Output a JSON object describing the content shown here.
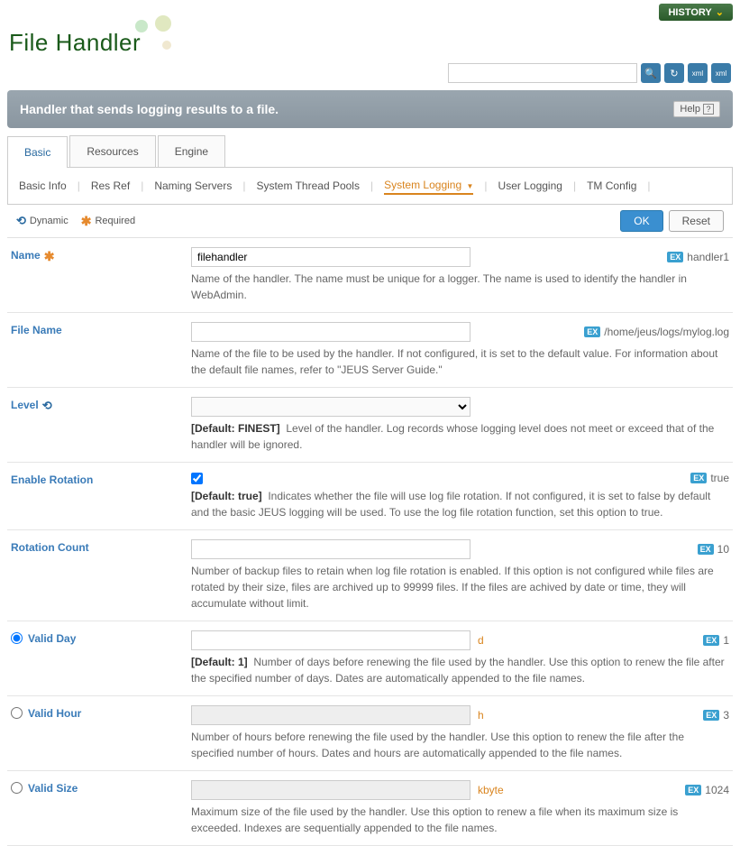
{
  "header": {
    "history_label": "HISTORY",
    "page_title": "File Handler",
    "search_placeholder": ""
  },
  "banner": {
    "description": "Handler that sends logging results to a file.",
    "help_label": "Help"
  },
  "tabs": {
    "items": [
      "Basic",
      "Resources",
      "Engine"
    ],
    "active": 0
  },
  "subtabs": {
    "items": [
      "Basic Info",
      "Res Ref",
      "Naming Servers",
      "System Thread Pools",
      "System Logging",
      "User Logging",
      "TM Config"
    ],
    "active": 4
  },
  "legend": {
    "dynamic": "Dynamic",
    "required": "Required"
  },
  "buttons": {
    "ok": "OK",
    "reset": "Reset"
  },
  "fields": {
    "name": {
      "label": "Name",
      "value": "filehandler",
      "example": "handler1",
      "desc": "Name of the handler. The name must be unique for a logger. The name is used to identify the handler in WebAdmin."
    },
    "file_name": {
      "label": "File Name",
      "value": "",
      "example": "/home/jeus/logs/mylog.log",
      "desc": "Name of the file to be used by the handler. If not configured, it is set to the default value. For information about the default file names, refer to \"JEUS Server Guide.\""
    },
    "level": {
      "label": "Level",
      "default_prefix": "[Default: FINEST]",
      "desc": "Level of the handler. Log records whose logging level does not meet or exceed that of the handler will be ignored."
    },
    "enable_rotation": {
      "label": "Enable Rotation",
      "checked": true,
      "example": "true",
      "default_prefix": "[Default: true]",
      "desc": "Indicates whether the file will use log file rotation. If not configured, it is set to false by default and the basic JEUS logging will be used. To use the log file rotation function, set this option to true."
    },
    "rotation_count": {
      "label": "Rotation Count",
      "value": "",
      "example": "10",
      "desc": "Number of backup files to retain when log file rotation is enabled. If this option is not configured while files are rotated by their size, files are archived up to 99999 files. If the files are achived by date or time, they will accumulate without limit."
    },
    "valid_day": {
      "label": "Valid Day",
      "unit": "d",
      "example": "1",
      "default_prefix": "[Default: 1]",
      "desc": "Number of days before renewing the file used by the handler. Use this option to renew the file after the specified number of days. Dates are automatically appended to the file names."
    },
    "valid_hour": {
      "label": "Valid Hour",
      "unit": "h",
      "example": "3",
      "desc": "Number of hours before renewing the file used by the handler. Use this option to renew the file after the specified number of hours. Dates and hours are automatically appended to the file names."
    },
    "valid_size": {
      "label": "Valid Size",
      "unit": "kbyte",
      "example": "1024",
      "desc": "Maximum size of the file used by the handler. Use this option to renew a file when its maximum size is exceeded. Indexes are sequentially appended to the file names."
    }
  }
}
